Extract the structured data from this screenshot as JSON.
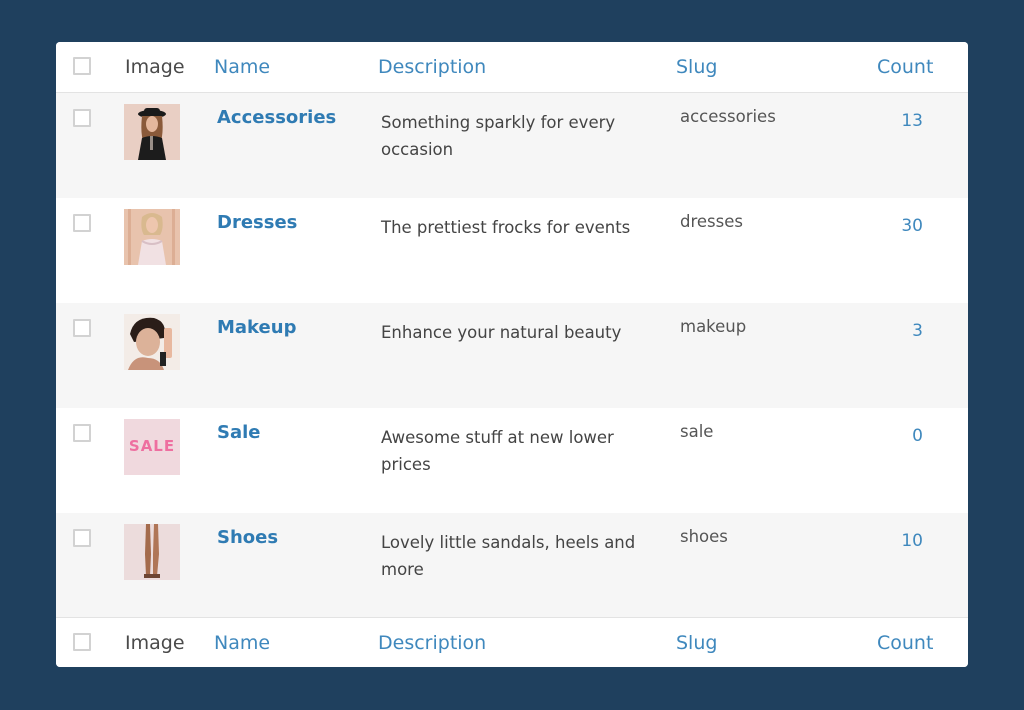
{
  "table": {
    "columns": {
      "image": "Image",
      "name": "Name",
      "description": "Description",
      "slug": "Slug",
      "count": "Count"
    },
    "rows": [
      {
        "name": "Accessories",
        "description": "Something sparkly for every occasion",
        "slug": "accessories",
        "count": "13",
        "image_icon": "woman-in-hat-photo"
      },
      {
        "name": "Dresses",
        "description": "The prettiest frocks for events",
        "slug": "dresses",
        "count": "30",
        "image_icon": "woman-in-dress-photo"
      },
      {
        "name": "Makeup",
        "description": "Enhance your natural beauty",
        "slug": "makeup",
        "count": "3",
        "image_icon": "woman-makeup-photo"
      },
      {
        "name": "Sale",
        "description": "Awesome stuff at new lower prices",
        "slug": "sale",
        "count": "0",
        "image_icon": "sale-badge",
        "image_text": "SALE"
      },
      {
        "name": "Shoes",
        "description": "Lovely little sandals, heels and more",
        "slug": "shoes",
        "count": "10",
        "image_icon": "legs-in-shoes-photo"
      }
    ]
  },
  "colors": {
    "background": "#1f405e",
    "link": "#2f7bb3",
    "header_link": "#3f88bd",
    "sale_pink": "#ee6fa0"
  }
}
